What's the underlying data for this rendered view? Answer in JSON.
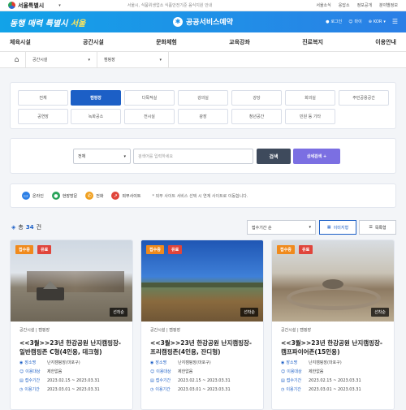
{
  "topbar": {
    "seoul": "서울특별시",
    "notice": "서울시, 식품위생업소 식품안전기준 음식지원 안내",
    "links": [
      "서울소식",
      "응답소",
      "정보공개",
      "분야별정보"
    ]
  },
  "header": {
    "slogan_a": "동행 매력 특별시 ",
    "slogan_b": "서울",
    "brand": "공공서비스예약",
    "login": "로그인",
    "mypage": "마이",
    "lang": "KOR"
  },
  "gnb": [
    "체육시설",
    "공간시설",
    "문화체험",
    "교육강좌",
    "진료복지",
    "이용안내"
  ],
  "breadcrumb": {
    "seg1": "공간시설",
    "seg2": "캠핑장"
  },
  "categories": [
    "전체",
    "캠핑장",
    "다목적실",
    "강의실",
    "강당",
    "회의실",
    "주민공용공간",
    "공연장",
    "녹화공소",
    "전시실",
    "광장",
    "청년공간",
    "민원 등 기타"
  ],
  "search": {
    "select": "전체",
    "placeholder": "검색어를 입력하세요",
    "btn": "검색",
    "detail": "상세검색 +"
  },
  "legend": {
    "items": [
      "온라인",
      "현장방문",
      "전화",
      "외부사이트"
    ],
    "note": "* 외부 사이트 서비스 선택 시 연계 사이트로 이동합니다."
  },
  "list": {
    "total_label": "총",
    "count": "34",
    "unit": "건",
    "sort": "접수기간 순",
    "view_image": "이미지형",
    "view_list": "목록형"
  },
  "cards": [
    {
      "tag1": "접수중",
      "tag2": "유료",
      "first": "선착순",
      "path1": "공간시설",
      "path2": "캠핑장",
      "title": "<<3월>>23년 한강공원 난지캠핑장-일반캠핑존 C형(4인용, 데크형)",
      "place_k": "장소명",
      "place": "난지캠핑장(마포구)",
      "target_k": "이용대상",
      "target": "제한없음",
      "period_k": "접수기간",
      "period": "2023.02.15 ~ 2023.03.31",
      "use_k": "이용기간",
      "use": "2023.03.01 ~ 2023.03.31"
    },
    {
      "tag1": "접수중",
      "tag2": "유료",
      "first": "선착순",
      "path1": "공간시설",
      "path2": "캠핑장",
      "title": "<<3월>>23년 한강공원 난지캠핑장-프리캠핑존(4인용, 잔디형)",
      "place_k": "장소명",
      "place": "난지캠핑장(마포구)",
      "target_k": "이용대상",
      "target": "제한없음",
      "period_k": "접수기간",
      "period": "2023.02.15 ~ 2023.03.31",
      "use_k": "이용기간",
      "use": "2023.03.01 ~ 2023.03.31"
    },
    {
      "tag1": "접수중",
      "tag2": "유료",
      "first": "선착순",
      "path1": "공간시설",
      "path2": "캠핑장",
      "title": "<<3월>>23년 한강공원 난지캠핑장-캠프파이어존(15인용)",
      "place_k": "장소명",
      "place": "난지캠핑장(마포구)",
      "target_k": "이용대상",
      "target": "제한없음",
      "period_k": "접수기간",
      "period": "2023.02.15 ~ 2023.03.31",
      "use_k": "이용기간",
      "use": "2023.03.01 ~ 2023.03.31"
    }
  ],
  "colors": {
    "primary": "#1c5fc6",
    "tag_open": "#f08a1c",
    "tag_paid": "#e0453b"
  }
}
